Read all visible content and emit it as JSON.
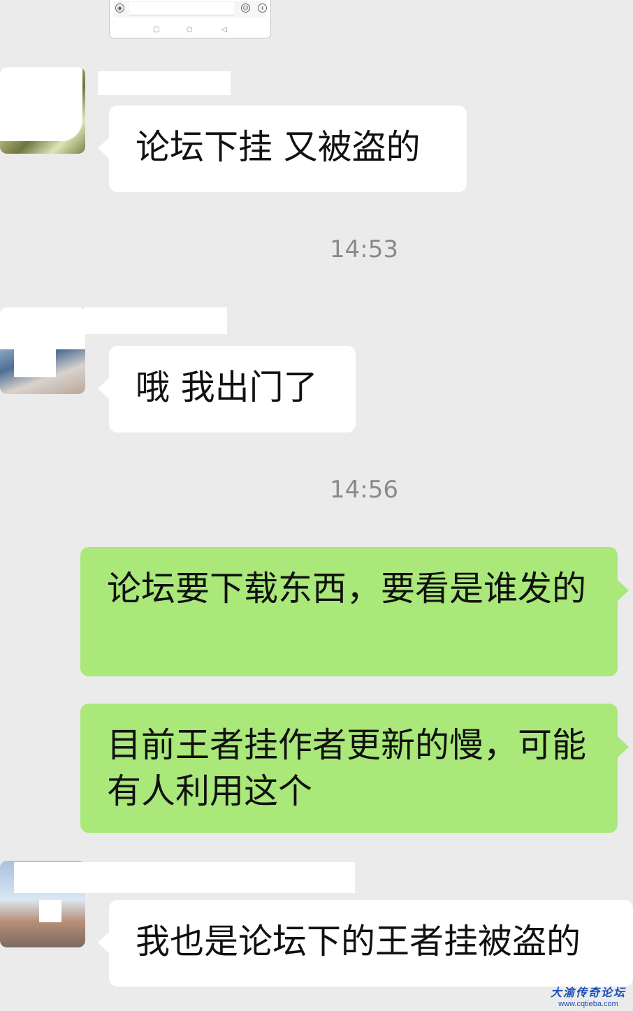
{
  "screenshot": {
    "nav_back": "◁",
    "nav_home": "○",
    "nav_recent": "□"
  },
  "messages": [
    {
      "side": "in",
      "text": "论坛下挂 又被盗的"
    },
    {
      "side": "time",
      "text": "14:53"
    },
    {
      "side": "in",
      "text": "哦 我出门了"
    },
    {
      "side": "time",
      "text": "14:56"
    },
    {
      "side": "out",
      "text": "论坛要下载东西，要看是谁发的"
    },
    {
      "side": "out",
      "text": "目前王者挂作者更新的慢，可能有人利用这个"
    },
    {
      "side": "in",
      "text": "我也是论坛下的王者挂被盗的"
    }
  ],
  "watermark": {
    "name": "大渝传奇论坛",
    "url": "www.cqtieba.com"
  },
  "colors": {
    "background": "#ebebeb",
    "incoming_bubble": "#ffffff",
    "outgoing_bubble": "#a9e879",
    "timestamp": "#8a8a8a"
  }
}
